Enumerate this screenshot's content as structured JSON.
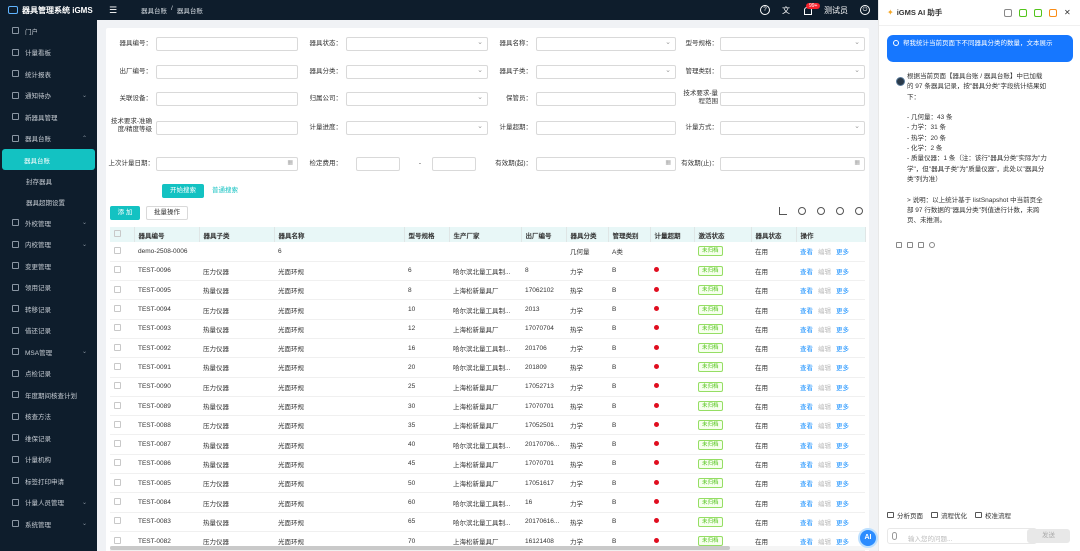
{
  "app": {
    "title": "器具管理系统 iGMS"
  },
  "sidebar": {
    "items": [
      {
        "label": "门户"
      },
      {
        "label": "计量看板"
      },
      {
        "label": "统计报表"
      },
      {
        "label": "通知待办",
        "chev": "⌄"
      },
      {
        "label": "新器具管理"
      },
      {
        "label": "器具台账",
        "chev": "⌃"
      }
    ],
    "sub_items": [
      {
        "label": "器具台账",
        "active": true
      },
      {
        "label": "封存器具"
      },
      {
        "label": "器具超期设置"
      }
    ],
    "items2": [
      {
        "label": "外校管理",
        "chev": "⌄"
      },
      {
        "label": "内校管理",
        "chev": "⌄"
      },
      {
        "label": "变更管理"
      },
      {
        "label": "领用记录"
      },
      {
        "label": "转移记录"
      },
      {
        "label": "借还记录"
      },
      {
        "label": "MSA管理",
        "chev": "⌄"
      },
      {
        "label": "点检记录"
      },
      {
        "label": "年度期间核查计划"
      },
      {
        "label": "核查方法"
      },
      {
        "label": "维保记录"
      },
      {
        "label": "计量机构"
      },
      {
        "label": "标签打印申请"
      },
      {
        "label": "计量人员管理",
        "chev": "⌄"
      },
      {
        "label": "系统管理",
        "chev": "⌄"
      }
    ]
  },
  "topbar": {
    "crumb1": "器具台账",
    "crumb2": "器具台账",
    "badge": "99+",
    "user": "测试员"
  },
  "filters": {
    "r1": [
      "器具编号：",
      "器具状态：",
      "器具名称：",
      "型号规格："
    ],
    "r2": [
      "出厂编号：",
      "器具分类：",
      "器具子类：",
      "管理类别："
    ],
    "r3": [
      "关联设备：",
      "归属公司：",
      "保管员：",
      "技术要求-量程范围"
    ],
    "r4": [
      "技术要求-准确度/精度等级",
      "计量进度：",
      "计量超期：",
      "计量方式："
    ],
    "r5": [
      "上次计量日期：",
      "检定费用：",
      "有效期(起)：",
      "有效期(止)："
    ],
    "dash": "-",
    "search": "开始搜索",
    "simple": "普通搜索"
  },
  "table": {
    "add": "添 加",
    "batch": "批量操作",
    "headers": [
      "",
      "器具编号",
      "器具子类",
      "器具名称",
      "型号规格",
      "生产厂家",
      "出厂编号",
      "器具分类",
      "管理类别",
      "计量超期",
      "激活状态",
      "器具状态",
      "操作"
    ],
    "ops": {
      "view": "查看",
      "edit": "编辑",
      "more": "更多"
    },
    "rows": [
      {
        "code": "demo-2508-0006",
        "sub": "",
        "name": "6",
        "model": "",
        "maker": "",
        "serial": "",
        "cat": "几何量",
        "mgmt": "A类",
        "over": false,
        "act": "未归档",
        "state": "在用"
      },
      {
        "code": "TEST-0096",
        "sub": "压力仪器",
        "name": "光面环规",
        "model": "6",
        "maker": "哈尔滨北量工具制...",
        "serial": "8",
        "cat": "力学",
        "mgmt": "B",
        "over": true,
        "act": "未归档",
        "state": "在用"
      },
      {
        "code": "TEST-0095",
        "sub": "热量仪器",
        "name": "光面环规",
        "model": "8",
        "maker": "上海松新量具厂",
        "serial": "17062102",
        "cat": "热学",
        "mgmt": "B",
        "over": true,
        "act": "未归档",
        "state": "在用"
      },
      {
        "code": "TEST-0094",
        "sub": "压力仪器",
        "name": "光面环规",
        "model": "10",
        "maker": "哈尔滨北量工具制...",
        "serial": "2013",
        "cat": "力学",
        "mgmt": "B",
        "over": true,
        "act": "未归档",
        "state": "在用"
      },
      {
        "code": "TEST-0093",
        "sub": "热量仪器",
        "name": "光面环规",
        "model": "12",
        "maker": "上海松新量具厂",
        "serial": "17070704",
        "cat": "热学",
        "mgmt": "B",
        "over": true,
        "act": "未归档",
        "state": "在用"
      },
      {
        "code": "TEST-0092",
        "sub": "压力仪器",
        "name": "光面环规",
        "model": "16",
        "maker": "哈尔滨北量工具制...",
        "serial": "201706",
        "cat": "力学",
        "mgmt": "B",
        "over": true,
        "act": "未归档",
        "state": "在用"
      },
      {
        "code": "TEST-0091",
        "sub": "热量仪器",
        "name": "光面环规",
        "model": "20",
        "maker": "哈尔滨北量工具制...",
        "serial": "201809",
        "cat": "热学",
        "mgmt": "B",
        "over": true,
        "act": "未归档",
        "state": "在用"
      },
      {
        "code": "TEST-0090",
        "sub": "压力仪器",
        "name": "光面环规",
        "model": "25",
        "maker": "上海松新量具厂",
        "serial": "17052713",
        "cat": "力学",
        "mgmt": "B",
        "over": true,
        "act": "未归档",
        "state": "在用"
      },
      {
        "code": "TEST-0089",
        "sub": "热量仪器",
        "name": "光面环规",
        "model": "30",
        "maker": "上海松新量具厂",
        "serial": "17070701",
        "cat": "热学",
        "mgmt": "B",
        "over": true,
        "act": "未归档",
        "state": "在用"
      },
      {
        "code": "TEST-0088",
        "sub": "压力仪器",
        "name": "光面环规",
        "model": "35",
        "maker": "上海松新量具厂",
        "serial": "17052501",
        "cat": "力学",
        "mgmt": "B",
        "over": true,
        "act": "未归档",
        "state": "在用"
      },
      {
        "code": "TEST-0087",
        "sub": "热量仪器",
        "name": "光面环规",
        "model": "40",
        "maker": "哈尔滨北量工具制...",
        "serial": "20170706...",
        "cat": "热学",
        "mgmt": "B",
        "over": true,
        "act": "未归档",
        "state": "在用"
      },
      {
        "code": "TEST-0086",
        "sub": "热量仪器",
        "name": "光面环规",
        "model": "45",
        "maker": "上海松新量具厂",
        "serial": "17070701",
        "cat": "热学",
        "mgmt": "B",
        "over": true,
        "act": "未归档",
        "state": "在用"
      },
      {
        "code": "TEST-0085",
        "sub": "压力仪器",
        "name": "光面环规",
        "model": "50",
        "maker": "上海松新量具厂",
        "serial": "17051617",
        "cat": "力学",
        "mgmt": "B",
        "over": true,
        "act": "未归档",
        "state": "在用"
      },
      {
        "code": "TEST-0084",
        "sub": "压力仪器",
        "name": "光面环规",
        "model": "60",
        "maker": "哈尔滨北量工具制...",
        "serial": "16",
        "cat": "力学",
        "mgmt": "B",
        "over": true,
        "act": "未归档",
        "state": "在用"
      },
      {
        "code": "TEST-0083",
        "sub": "热量仪器",
        "name": "光面环规",
        "model": "65",
        "maker": "哈尔滨北量工具制...",
        "serial": "20170616...",
        "cat": "热学",
        "mgmt": "B",
        "over": true,
        "act": "未归档",
        "state": "在用"
      },
      {
        "code": "TEST-0082",
        "sub": "压力仪器",
        "name": "光面环规",
        "model": "70",
        "maker": "上海松新量具厂",
        "serial": "16121408",
        "cat": "力学",
        "mgmt": "B",
        "over": true,
        "act": "未归档",
        "state": "在用"
      }
    ]
  },
  "ai": {
    "title": "iGMS AI 助手",
    "user_msg": "帮我统计当前页面下不同器具分类的数量，文本展示",
    "reply": [
      "根据当前页面【器具台账 / 器具台账】中已加载",
      "的 97 条器具记录，按\"器具分类\"字段统计结果如",
      "下：",
      "",
      "- 几何量：43 条",
      "- 力学：31 条",
      "- 热学：20 条",
      "- 化学：2 条",
      "- 质量仪器：1 条（注：该行\"器具分类\"实际为\"力",
      "学\"，但\"器具子类\"为\"质量仪器\"，此处以\"器具分",
      "类\"列为准）",
      "",
      "> 说明：以上统计基于 listSnapshot 中当前页全",
      "部 97 行数据的\"器具分类\"列值进行计数，未跨",
      "页、未推测。"
    ],
    "sugs": [
      "分析页面",
      "流程优化",
      "校准流程"
    ],
    "placeholder": "输入您的问题...",
    "send": "发送",
    "float": "AI"
  }
}
